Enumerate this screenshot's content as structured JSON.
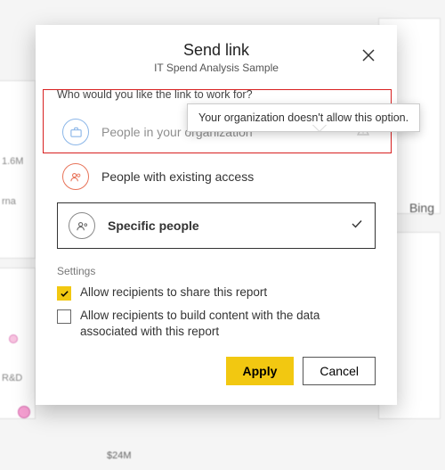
{
  "dialog": {
    "title": "Send link",
    "subtitle": "IT Spend Analysis Sample",
    "prompt": "Who would you like the link to work for?",
    "options": {
      "org": {
        "label": "People in your organization",
        "enabled": false
      },
      "existing": {
        "label": "People with existing access",
        "enabled": true
      },
      "specific": {
        "label": "Specific people",
        "enabled": true,
        "selected": true
      }
    },
    "settings_header": "Settings",
    "settings": {
      "allow_share": {
        "label": "Allow recipients to share this report",
        "checked": true
      },
      "allow_build": {
        "label": "Allow recipients to build content with the data associated with this report",
        "checked": false
      }
    },
    "actions": {
      "apply": "Apply",
      "cancel": "Cancel"
    }
  },
  "tooltip": {
    "text": "Your organization doesn't allow this option."
  },
  "background": {
    "label_1_6m": "1.6M",
    "label_rna": "rna",
    "label_rd": "R&D",
    "label_24m": "$24M",
    "bing": "Bing"
  }
}
